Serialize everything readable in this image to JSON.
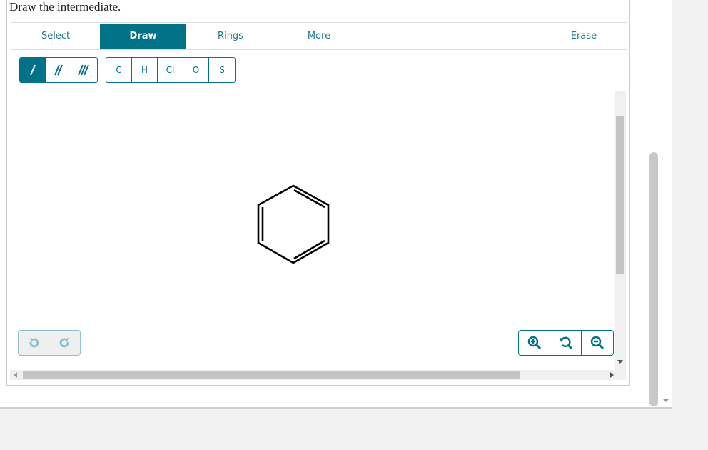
{
  "prompt": "Draw the intermediate.",
  "tabs": [
    {
      "label": "Select"
    },
    {
      "label": "Draw",
      "active": true
    },
    {
      "label": "Rings"
    },
    {
      "label": "More"
    },
    {
      "label": "Erase"
    }
  ],
  "bonds": [
    {
      "icon": "single-bond-icon",
      "selected": true
    },
    {
      "icon": "double-bond-icon"
    },
    {
      "icon": "triple-bond-icon"
    }
  ],
  "atoms": [
    "C",
    "H",
    "Cl",
    "O",
    "S"
  ],
  "molecule": {
    "name": "cyclohexatriene ring",
    "double_bonds": [
      1,
      3,
      5
    ]
  },
  "history": [
    {
      "icon": "undo-icon",
      "enabled": false
    },
    {
      "icon": "redo-icon",
      "enabled": false
    }
  ],
  "zoom": [
    {
      "icon": "zoom-in-icon"
    },
    {
      "icon": "reset-zoom-icon"
    },
    {
      "icon": "zoom-out-icon"
    }
  ],
  "colors": {
    "accent": "#007389",
    "disabled": "#8fc0cb"
  }
}
